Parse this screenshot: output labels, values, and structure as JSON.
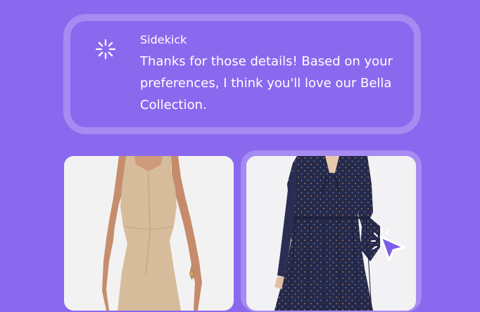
{
  "chat": {
    "sender": "Sidekick",
    "message": "Thanks for those details! Based on your preferences, I think you'll love our Bella Collection.",
    "icon": "sparkle-icon"
  },
  "products": [
    {
      "name": "product-card-beige-dress",
      "image": "beige sleeveless dress"
    },
    {
      "name": "product-card-navy-dress",
      "image": "navy polka-dot dress"
    }
  ],
  "colors": {
    "background": "#8b69ee",
    "bubble_border": "#a58bf2",
    "text": "#ffffff"
  },
  "cursor_icon": "pointer-cursor-icon"
}
